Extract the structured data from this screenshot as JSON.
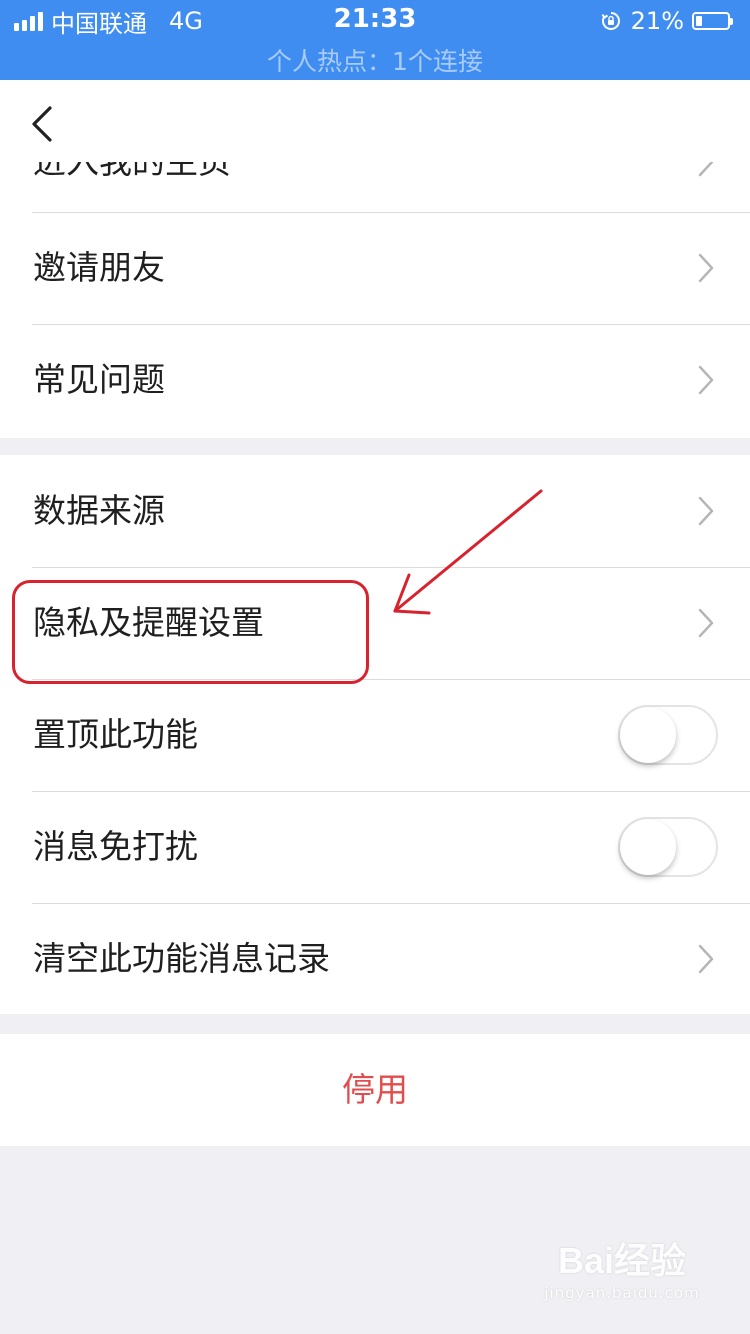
{
  "status_bar": {
    "carrier": "中国联通",
    "network": "4G",
    "time": "21:33",
    "battery": "21%",
    "battery_level": 0.21,
    "hotspot": "个人热点：1个连接"
  },
  "colors": {
    "status_bar_bg": "#3f8df1",
    "danger_text": "#e24c4c",
    "annotation": "#d8232f"
  },
  "settings": {
    "partial_item": "进入我的主页",
    "group1": [
      {
        "label": "邀请朋友"
      },
      {
        "label": "常见问题"
      }
    ],
    "group2": [
      {
        "label": "数据来源",
        "type": "link"
      },
      {
        "label": "隐私及提醒设置",
        "type": "link"
      },
      {
        "label": "置顶此功能",
        "type": "toggle",
        "on": false
      },
      {
        "label": "消息免打扰",
        "type": "toggle",
        "on": false
      },
      {
        "label": "清空此功能消息记录",
        "type": "link"
      }
    ]
  },
  "disable_button": "停用",
  "watermark": {
    "logo": "Bai经验",
    "url": "jingyan.baidu.com"
  }
}
